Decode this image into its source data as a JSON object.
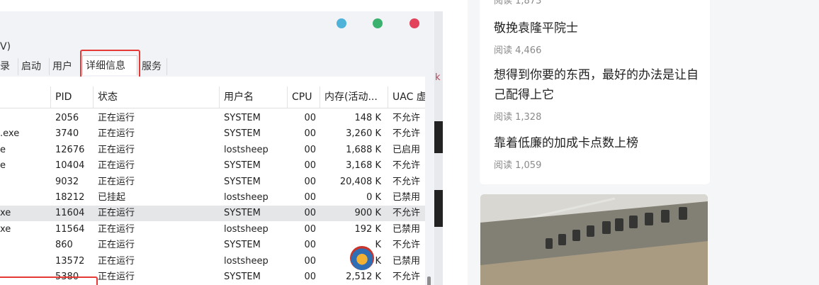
{
  "window": {
    "menu_fragment": "V)",
    "controls": [
      {
        "name": "minimize-dot",
        "color": "#4fb2d9"
      },
      {
        "name": "maximize-dot",
        "color": "#3ab16c"
      },
      {
        "name": "close-dot",
        "color": "#e2425a"
      }
    ],
    "tabs": [
      "录",
      "启动",
      "用户",
      "详细信息",
      "服务"
    ],
    "active_tab": "详细信息",
    "columns": [
      "PID",
      "状态",
      "用户名",
      "CPU",
      "内存(活动...",
      "UAC 虚"
    ],
    "rows": [
      {
        "name": "",
        "pid": "2056",
        "status": "正在运行",
        "user": "SYSTEM",
        "cpu": "00",
        "mem": "148 K",
        "uac": "不允许"
      },
      {
        "name": ".exe",
        "pid": "3740",
        "status": "正在运行",
        "user": "SYSTEM",
        "cpu": "00",
        "mem": "3,260 K",
        "uac": "不允许"
      },
      {
        "name": "e",
        "pid": "12676",
        "status": "正在运行",
        "user": "lostsheep",
        "cpu": "00",
        "mem": "1,688 K",
        "uac": "已启用"
      },
      {
        "name": "e",
        "pid": "10404",
        "status": "正在运行",
        "user": "SYSTEM",
        "cpu": "00",
        "mem": "3,168 K",
        "uac": "不允许"
      },
      {
        "name": "",
        "pid": "9032",
        "status": "正在运行",
        "user": "SYSTEM",
        "cpu": "00",
        "mem": "20,408 K",
        "uac": "不允许"
      },
      {
        "name": "",
        "pid": "18212",
        "status": "已挂起",
        "user": "lostsheep",
        "cpu": "00",
        "mem": "0 K",
        "uac": "已禁用"
      },
      {
        "name": "xe",
        "pid": "11604",
        "status": "正在运行",
        "user": "SYSTEM",
        "cpu": "00",
        "mem": "900 K",
        "uac": "不允许",
        "selected": true
      },
      {
        "name": "xe",
        "pid": "11564",
        "status": "正在运行",
        "user": "lostsheep",
        "cpu": "00",
        "mem": "192 K",
        "uac": "已禁用"
      },
      {
        "name": "",
        "pid": "860",
        "status": "正在运行",
        "user": "SYSTEM",
        "cpu": "00",
        "mem": "K",
        "uac": "不允许"
      },
      {
        "name": "",
        "pid": "13572",
        "status": "正在运行",
        "user": "lostsheep",
        "cpu": "00",
        "mem": "820 K",
        "uac": "已禁用"
      },
      {
        "name": "",
        "pid": "5380",
        "status": "正在运行",
        "user": "SYSTEM",
        "cpu": "00",
        "mem": "2,512 K",
        "uac": "不允许"
      }
    ]
  },
  "sidebar": {
    "top_read_fragment": "阅读 1,873",
    "articles": [
      {
        "title": "敬挽袁隆平院士",
        "reads": "阅读 4,466"
      },
      {
        "title": "想得到你要的东西，最好的办法是让自己配得上它",
        "reads": "阅读 1,328"
      },
      {
        "title": "靠着低廉的加成卡点数上榜",
        "reads": "阅读 1,059"
      }
    ]
  },
  "strip_letter": "k"
}
